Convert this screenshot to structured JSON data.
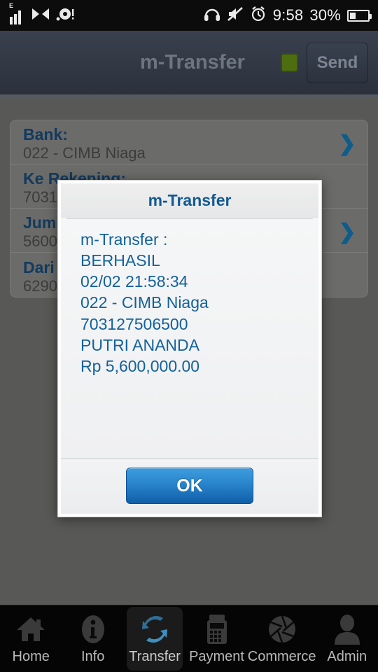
{
  "statusbar": {
    "network_label": "E",
    "time": "9:58",
    "battery_percent": "30%",
    "icons": [
      "signal-bars-icon",
      "bow-tie-icon",
      "disc-icon",
      "headphones-icon",
      "mute-icon",
      "alarm-clock-icon",
      "battery-icon"
    ]
  },
  "header": {
    "title": "m-Transfer",
    "send_label": "Send",
    "indicator_color": "#4e6d10"
  },
  "form": {
    "rows": [
      {
        "label": "Bank:",
        "value": "022 - CIMB Niaga",
        "has_chevron": true
      },
      {
        "label": "Ke Rekening:",
        "value": "703127506500",
        "has_chevron": false
      },
      {
        "label": "Jumlah:",
        "value": "5600000",
        "has_chevron": true
      },
      {
        "label": "Dari Rekening:",
        "value": "62900",
        "has_chevron": false
      }
    ]
  },
  "dialog": {
    "title": "m-Transfer",
    "lines": [
      "m-Transfer :",
      "BERHASIL",
      "02/02 21:58:34",
      "022 - CIMB Niaga",
      "703127506500",
      "PUTRI ANANDA",
      "Rp 5,600,000.00"
    ],
    "ok_label": "OK",
    "text_color": "#13619b"
  },
  "tabbar": {
    "items": [
      {
        "label": "Home",
        "icon": "home-icon",
        "active": false
      },
      {
        "label": "Info",
        "icon": "info-icon",
        "active": false
      },
      {
        "label": "Transfer",
        "icon": "transfer-icon",
        "active": true
      },
      {
        "label": "Payment",
        "icon": "payment-terminal-icon",
        "active": false
      },
      {
        "label": "Commerce",
        "icon": "aperture-icon",
        "active": false
      },
      {
        "label": "Admin",
        "icon": "person-icon",
        "active": false
      }
    ]
  }
}
